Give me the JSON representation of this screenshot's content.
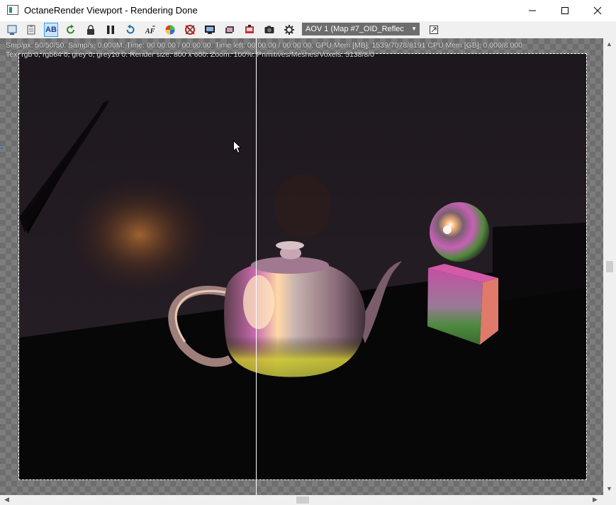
{
  "window": {
    "title": "OctaneRender Viewport - Rendering Done"
  },
  "toolbar": {
    "buttons": [
      {
        "name": "send-to-viewport-icon"
      },
      {
        "name": "clipboard-icon"
      },
      {
        "name": "ab-compare-button",
        "label": "AB",
        "active": true
      },
      {
        "name": "restart-render-icon"
      },
      {
        "name": "lock-icon"
      },
      {
        "name": "pause-icon"
      },
      {
        "name": "refresh-icon"
      },
      {
        "name": "autofocus-icon",
        "label": "AF"
      },
      {
        "name": "color-picker-icon"
      },
      {
        "name": "region-render-icon"
      },
      {
        "name": "monitor-icon"
      },
      {
        "name": "film-settings-icon"
      },
      {
        "name": "save-image-icon"
      },
      {
        "name": "camera-icon"
      },
      {
        "name": "settings-gear-icon"
      }
    ],
    "aov_select": "AOV 1 (Map #7_OID_Reflec",
    "fit_button": "fit-view-icon"
  },
  "stats": {
    "line1": "Smp/px: 50/50/50.   Samp/s: 0.000M.   Time: 00:00:00 / 00:00:00.   Time left: 00:00:00 / 00:00:00.   GPU Mem [MB]: 1539/7078/8191   CPU Mem [GB]: 0.000/8.000",
    "line2": "Tex: rgb 0, rgb64 0, grey 0, grey16 0.   Render size: 800 x 600.   Zoom: 100%.   Primitives/Meshes/Voxels: 5138/8/0"
  },
  "colors": {
    "accent": "#3399ff",
    "aov_bg": "#6d6d6d",
    "render_bg": "#100d10"
  }
}
